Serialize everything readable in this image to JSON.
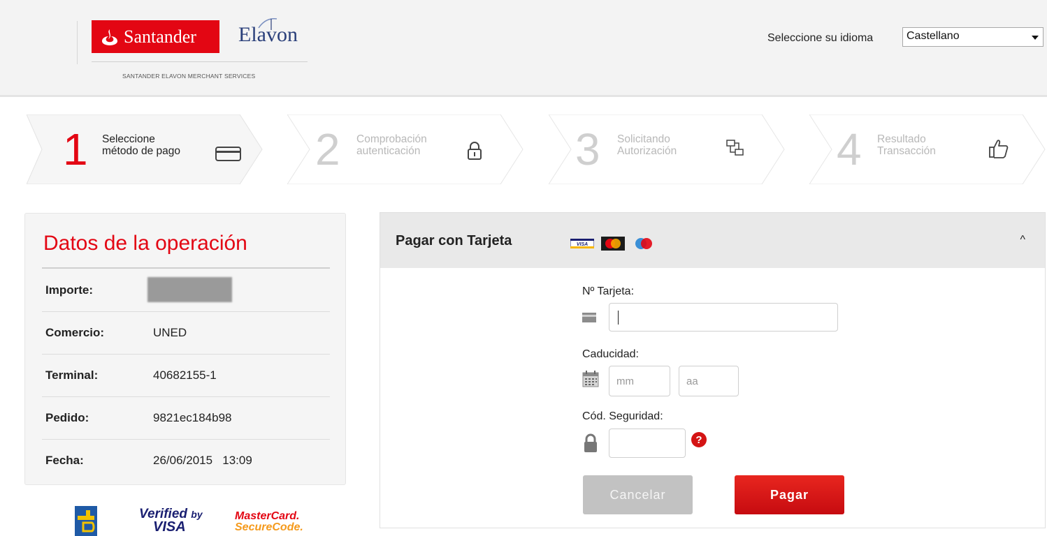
{
  "header": {
    "brand_name": "Santander",
    "partner_name": "Elavon",
    "brand_subtitle": "SANTANDER ELAVON MERCHANT SERVICES",
    "language_label": "Seleccione su idioma",
    "language_selected": "Castellano"
  },
  "steps": [
    {
      "number": "1",
      "line1": "Seleccione",
      "line2": "método de pago",
      "icon": "credit-card-icon",
      "active": true
    },
    {
      "number": "2",
      "line1": "Comprobación",
      "line2": "autenticación",
      "icon": "lock-icon",
      "active": false
    },
    {
      "number": "3",
      "line1": "Solicitando",
      "line2": "Autorización",
      "icon": "network-icon",
      "active": false
    },
    {
      "number": "4",
      "line1": "Resultado",
      "line2": "Transacción",
      "icon": "thumbs-up-icon",
      "active": false
    }
  ],
  "operation": {
    "title": "Datos de la operación",
    "rows": [
      {
        "label": "Importe:",
        "value": ""
      },
      {
        "label": "Comercio:",
        "value": "UNED"
      },
      {
        "label": "Terminal:",
        "value": "40682155-1"
      },
      {
        "label": "Pedido:",
        "value": "9821ec184b98"
      },
      {
        "label": "Fecha:",
        "value": "26/06/2015   13:09"
      }
    ]
  },
  "secure_logos": {
    "verified_line1": "Verified",
    "verified_by": "by",
    "verified_line2": "VISA",
    "mc_line1": "MasterCard.",
    "mc_line2": "SecureCode."
  },
  "card_form": {
    "title": "Pagar con Tarjeta",
    "card_brands": [
      "VISA",
      "MasterCard",
      "Maestro"
    ],
    "card_number_label": "Nº Tarjeta:",
    "card_number_value": "",
    "expiry_label": "Caducidad:",
    "month_placeholder": "mm",
    "year_placeholder": "aa",
    "cvv_label": "Cód. Seguridad:",
    "cvv_value": "",
    "help_glyph": "?",
    "cancel_label": "Cancelar",
    "pay_label": "Pagar",
    "collapse_glyph": "^"
  },
  "colors": {
    "brand_red": "#e30613",
    "inactive_step": "#cfcfcf",
    "panel_bg": "#f5f5f5"
  }
}
